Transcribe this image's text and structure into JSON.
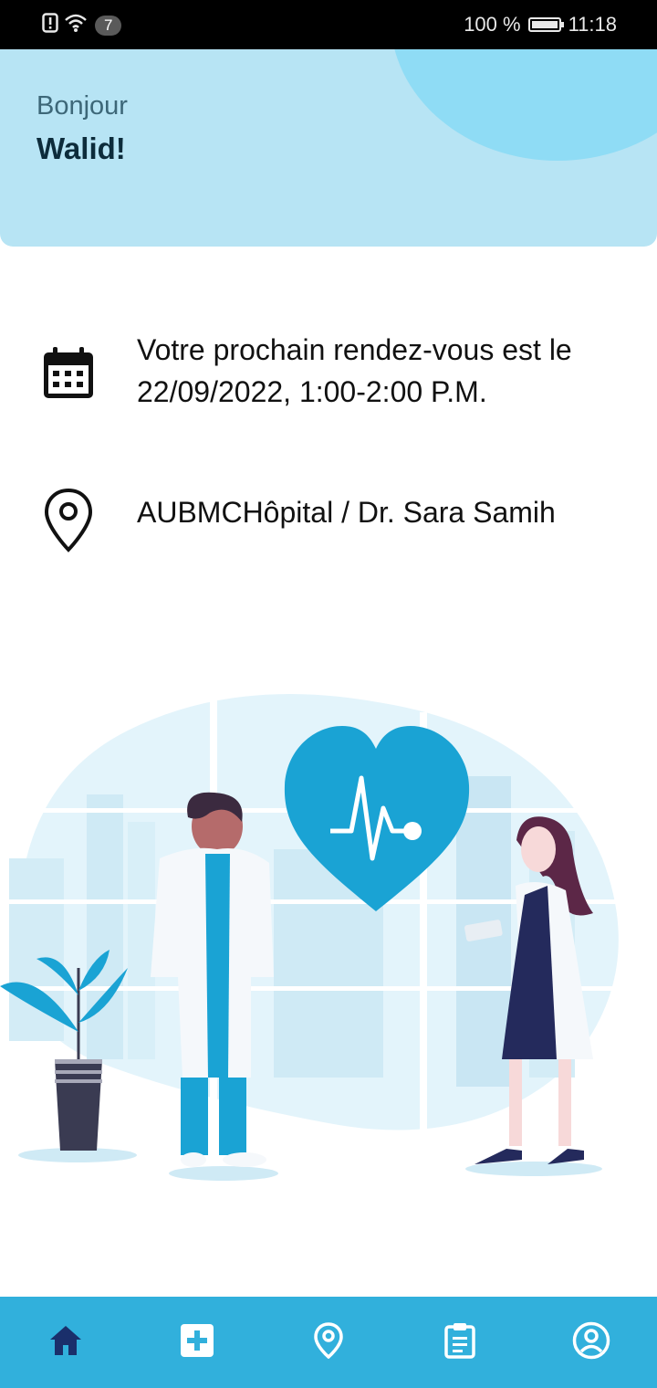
{
  "status_bar": {
    "notification_count": "7",
    "battery_percent": "100 %",
    "time": "11:18",
    "icons": [
      "alert-icon",
      "wifi-icon",
      "battery-icon"
    ]
  },
  "header": {
    "greeting": "Bonjour",
    "username": "Walid!"
  },
  "appointment": {
    "text_line1": "Votre prochain rendez-vous est le",
    "text_line2": "22/09/2022, 1:00-2:00 P.M.",
    "icon": "calendar-icon"
  },
  "location": {
    "text": "AUBMCHôpital / Dr. Sara Samih",
    "icon": "location-pin-icon"
  },
  "bottom_nav": {
    "items": [
      {
        "icon": "home-icon",
        "active": true
      },
      {
        "icon": "medical-plus-icon",
        "active": false
      },
      {
        "icon": "location-icon",
        "active": false
      },
      {
        "icon": "clipboard-icon",
        "active": false
      },
      {
        "icon": "profile-icon",
        "active": false
      }
    ]
  },
  "colors": {
    "header_bg": "#b7e4f4",
    "header_circle": "#8fdcf5",
    "nav_bg": "#31b0dc",
    "nav_active": "#1a2f6b",
    "nav_inactive": "#ffffff",
    "heart": "#1aa3d4"
  }
}
